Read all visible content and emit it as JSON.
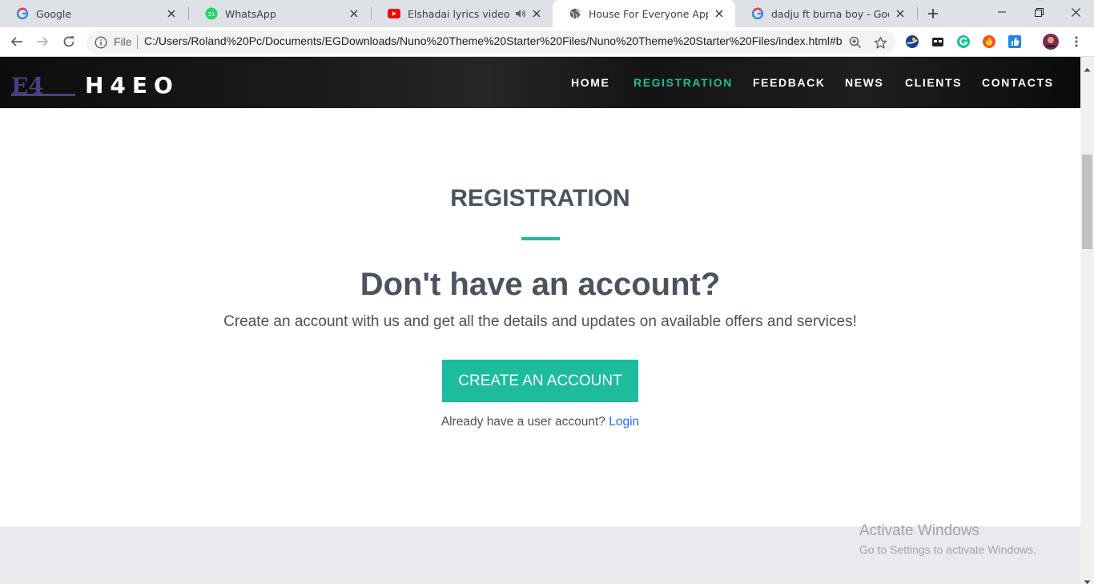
{
  "browser": {
    "tabs": [
      {
        "title": "Google",
        "favicon": "google-icon"
      },
      {
        "title": "WhatsApp",
        "favicon": "whatsapp-icon",
        "badge": "31"
      },
      {
        "title": "Elshadai lyrics video by H-",
        "favicon": "youtube-icon",
        "audio": "speaker-icon"
      },
      {
        "title": "House For Everyone App",
        "favicon": "globe-icon",
        "active": true
      },
      {
        "title": "dadju ft burna boy - Google Se",
        "favicon": "google-icon"
      }
    ],
    "omnibox": {
      "scheme": "File",
      "url": "C:/Users/Roland%20Pc/Documents/EGDownloads/Nuno%20Theme%20Starter%20Files/Nuno%20Theme%20Starter%20Files/index.html#b..."
    }
  },
  "site": {
    "logo_text": "H4EO",
    "logo_mark": "E4",
    "nav": [
      {
        "label": "HOME"
      },
      {
        "label": "REGISTRATION",
        "active": true
      },
      {
        "label": "FEEDBACK"
      },
      {
        "label": "NEWS"
      },
      {
        "label": "CLIENTS"
      },
      {
        "label": "CONTACTS"
      }
    ],
    "registration": {
      "title": "REGISTRATION",
      "heading": "Don't have an account?",
      "subtext": "Create an account with us and get all the details and updates on available offers and services!",
      "cta": "CREATE AN ACCOUNT",
      "already": "Already have a user account?",
      "login": "Login"
    }
  },
  "os_watermark": {
    "line1": "Activate Windows",
    "line2": "Go to Settings to activate Windows."
  },
  "colors": {
    "accent": "#1dbc9c",
    "text": "#4a535e",
    "link": "#1a73e8"
  }
}
